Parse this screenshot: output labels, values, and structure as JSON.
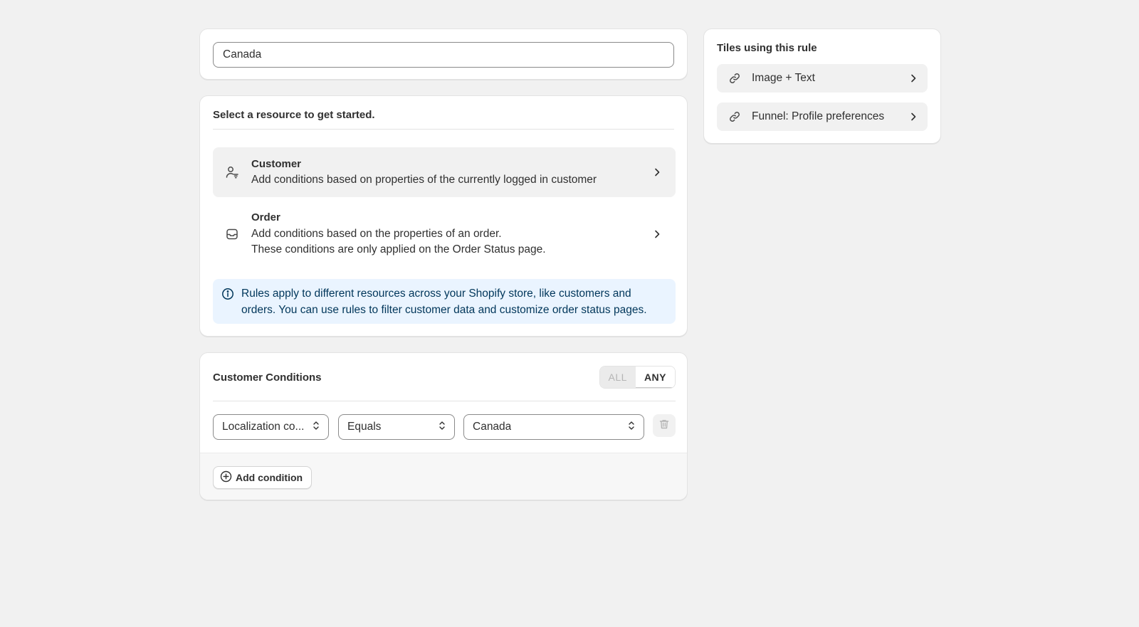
{
  "rule_name": {
    "value": "Canada"
  },
  "resources": {
    "heading": "Select a resource to get started.",
    "options": [
      {
        "icon": "customer-filter-icon",
        "title": "Customer",
        "description_lines": [
          "Add conditions based on properties of the currently logged in customer"
        ]
      },
      {
        "icon": "inbox-icon",
        "title": "Order",
        "description_lines": [
          "Add conditions based on the properties of an order.",
          "These conditions are only applied on the Order Status page."
        ]
      }
    ],
    "info_banner": {
      "icon": "info-icon",
      "lines": [
        "Rules apply to different resources across your Shopify store, like customers and",
        "orders. You can use rules to filter customer data and customize order status pages."
      ]
    }
  },
  "conditions": {
    "heading": "Customer Conditions",
    "match_toggle": {
      "all_label": "ALL",
      "any_label": "ANY",
      "selected": "ANY"
    },
    "rows": [
      {
        "field": "Localization co...",
        "operator": "Equals",
        "value": "Canada"
      }
    ],
    "add_label": "Add condition"
  },
  "tiles": {
    "heading": "Tiles using this rule",
    "items": [
      {
        "icon": "link-icon",
        "label": "Image + Text"
      },
      {
        "icon": "link-icon",
        "label": "Funnel: Profile preferences"
      }
    ]
  },
  "colors": {
    "background": "#f1f1f1",
    "card": "#ffffff",
    "banner_bg": "#eaf4ff",
    "banner_text": "#00365a",
    "text": "#303030",
    "muted": "#b5b5b5"
  }
}
